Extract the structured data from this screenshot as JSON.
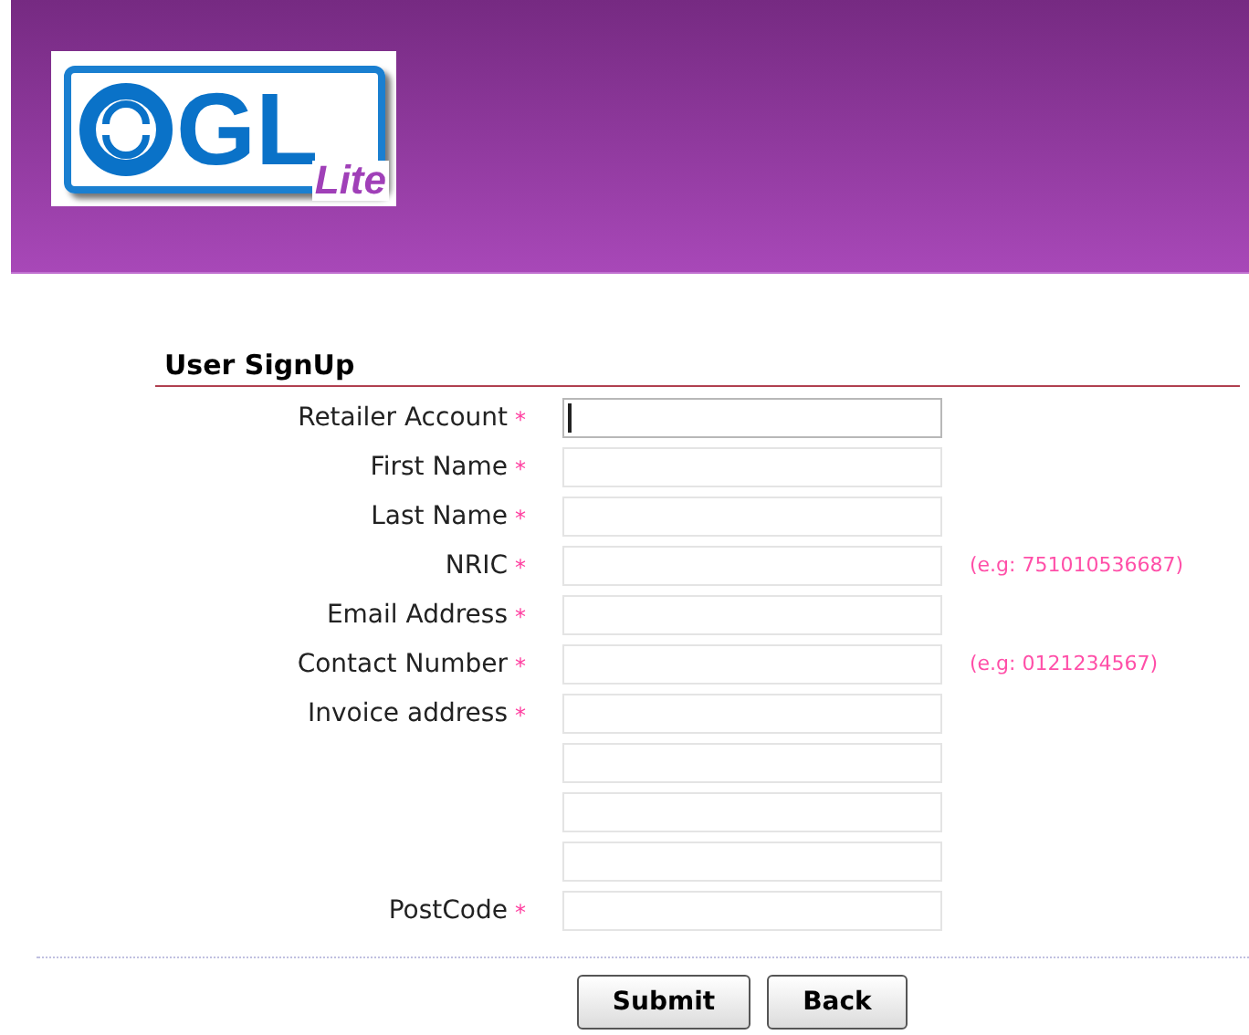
{
  "logo": {
    "letters": "GL",
    "badge": "Lite"
  },
  "form": {
    "title": "User SignUp",
    "rows": [
      {
        "kind": "field",
        "label": "Retailer Account",
        "required": "*",
        "focused": true
      },
      {
        "kind": "field",
        "label": "First Name",
        "required": "*",
        "focused": false
      },
      {
        "kind": "field",
        "label": "Last Name",
        "required": "*",
        "focused": false
      },
      {
        "kind": "field",
        "label": "NRIC",
        "required": "*",
        "hint": "(e.g: 751010536687)",
        "focused": false
      },
      {
        "kind": "field",
        "label": "Email Address",
        "required": "*",
        "focused": false
      },
      {
        "kind": "field",
        "label": "Contact Number",
        "required": "*",
        "hint": "(e.g: 0121234567)",
        "focused": false
      },
      {
        "kind": "field",
        "label": "Invoice address",
        "required": "*",
        "focused": false
      },
      {
        "kind": "continuation",
        "focused": false
      },
      {
        "kind": "continuation",
        "focused": false
      },
      {
        "kind": "continuation",
        "focused": false
      },
      {
        "kind": "field",
        "label": "PostCode",
        "required": "*",
        "focused": false
      }
    ],
    "buttons": [
      "Submit",
      "Back"
    ]
  }
}
